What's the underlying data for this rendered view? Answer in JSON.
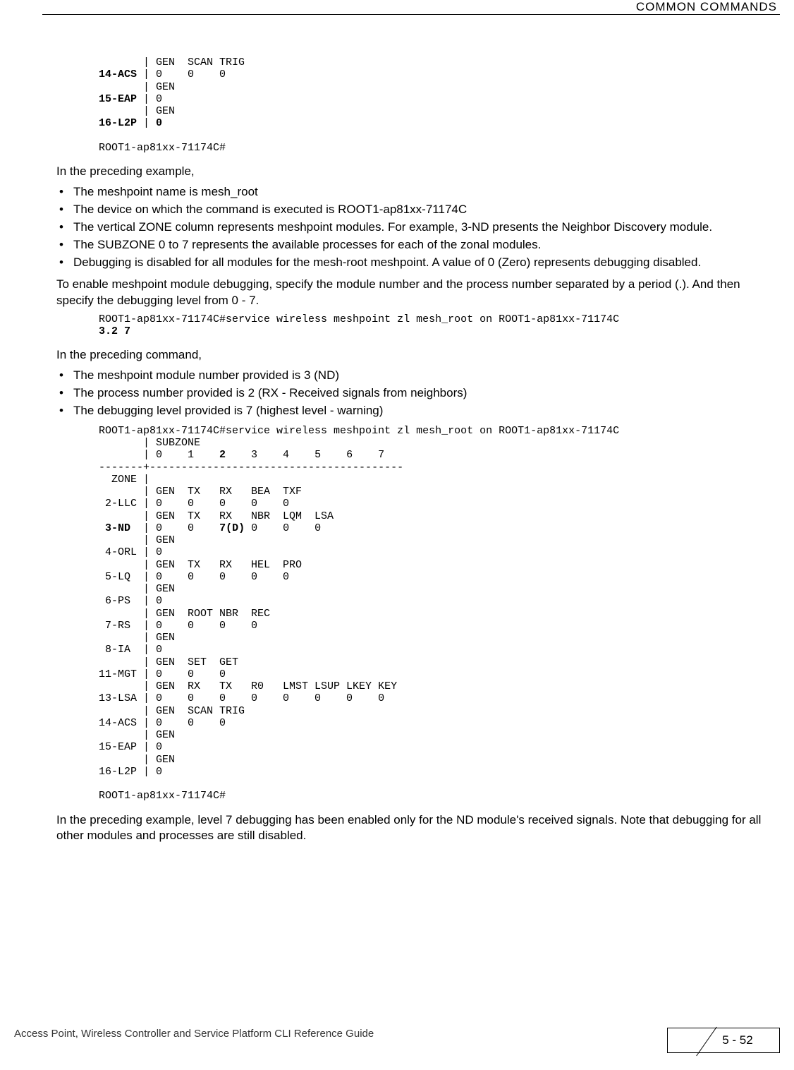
{
  "header": {
    "title": "COMMON COMMANDS"
  },
  "pre1_l1": "       | GEN  SCAN TRIG",
  "pre1_l2_bold": "14-ACS",
  "pre1_l2_rest": " | 0    0    0",
  "pre1_l3": "       | GEN",
  "pre1_l4_bold": "15-EAP",
  "pre1_l4_rest": " | 0",
  "pre1_l5": "       | GEN",
  "pre1_l6_bold": "16-L2P",
  "pre1_l6_rest": " | ",
  "pre1_l6_val": "0",
  "pre1_l8": "ROOT1-ap81xx-71174C#",
  "para1": "In the preceding example,",
  "bulletsA": {
    "b1": "The meshpoint name is mesh_root",
    "b2": "The device on which the command is executed is ROOT1-ap81xx-71174C",
    "b3": "The vertical ZONE column represents meshpoint modules. For example, 3-ND presents the Neighbor Discovery module.",
    "b4": "The SUBZONE 0 to 7 represents the available processes for each of the zonal modules.",
    "b5": "Debugging is disabled for all modules for the mesh-root meshpoint. A value of 0 (Zero) represents debugging disabled."
  },
  "para2": "To enable meshpoint module debugging, specify the module number and the process number separated by a period (.). And then specify the debugging level from 0 - 7.",
  "pre2_l1": "ROOT1-ap81xx-71174C#service wireless meshpoint zl mesh_root on ROOT1-ap81xx-71174C ",
  "pre2_l1_bold": "3.2 7",
  "para3": "In the preceding command,",
  "bulletsB": {
    "b1": "The meshpoint module number provided is 3 (ND)",
    "b2": "The process number provided is 2 (RX - Received signals from neighbors)",
    "b3": "The debugging level provided is 7 (highest level - warning)"
  },
  "pre3": {
    "l01": "ROOT1-ap81xx-71174C#service wireless meshpoint zl mesh_root on ROOT1-ap81xx-71174C",
    "l02": "       | SUBZONE",
    "l03a": "       | 0    1    ",
    "l03bold": "2",
    "l03b": "    3    4    5    6    7",
    "l04": "-------+----------------------------------------",
    "l05": "  ZONE |",
    "l06": "       | GEN  TX   RX   BEA  TXF",
    "l07": " 2-LLC | 0    0    0    0    0",
    "l08": "       | GEN  TX   RX   NBR  LQM  LSA",
    "l09a": " ",
    "l09bold1": "3-ND",
    "l09b": "  | 0    0    ",
    "l09bold2": "7(D)",
    "l09c": " 0    0    0",
    "l10": "       | GEN",
    "l11": " 4-ORL | 0",
    "l12": "       | GEN  TX   RX   HEL  PRO",
    "l13": " 5-LQ  | 0    0    0    0    0",
    "l14": "       | GEN",
    "l15": " 6-PS  | 0",
    "l16": "       | GEN  ROOT NBR  REC",
    "l17": " 7-RS  | 0    0    0    0",
    "l18": "       | GEN",
    "l19": " 8-IA  | 0",
    "l20": "       | GEN  SET  GET",
    "l21": "11-MGT | 0    0    0",
    "l22": "       | GEN  RX   TX   R0   LMST LSUP LKEY KEY",
    "l23": "13-LSA | 0    0    0    0    0    0    0    0",
    "l24": "       | GEN  SCAN TRIG",
    "l25": "14-ACS | 0    0    0",
    "l26": "       | GEN",
    "l27": "15-EAP | 0",
    "l28": "       | GEN",
    "l29": "16-L2P | 0",
    "l30": "",
    "l31": "ROOT1-ap81xx-71174C#"
  },
  "para4": "In the preceding example, level 7 debugging has been enabled only for the ND module's received signals. Note that debugging for all other modules and processes are still disabled.",
  "footer": {
    "text": "Access Point, Wireless Controller and Service Platform CLI Reference Guide",
    "page": "5 - 52"
  }
}
